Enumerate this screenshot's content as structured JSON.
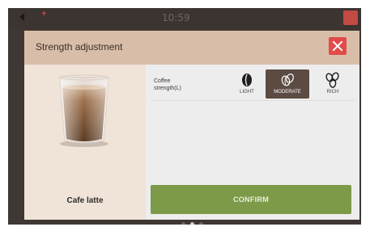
{
  "background": {
    "clock": "10:59"
  },
  "dialog": {
    "title": "Strength adjustment",
    "drink_name": "Cafe latte",
    "strength_label": "Coffee strength(L)",
    "options": [
      {
        "label": "LIGHT",
        "icon": "single-bean-icon",
        "selected": false
      },
      {
        "label": "MODERATE",
        "icon": "two-beans-icon",
        "selected": true
      },
      {
        "label": "RICH",
        "icon": "three-beans-icon",
        "selected": false
      }
    ],
    "confirm_label": "CONFIRM"
  },
  "pagination": {
    "pages": 3,
    "active": 1
  },
  "colors": {
    "header": "#d8bea9",
    "close": "#e34a4a",
    "selected": "#5c4b43",
    "confirm": "#7c9a47"
  }
}
